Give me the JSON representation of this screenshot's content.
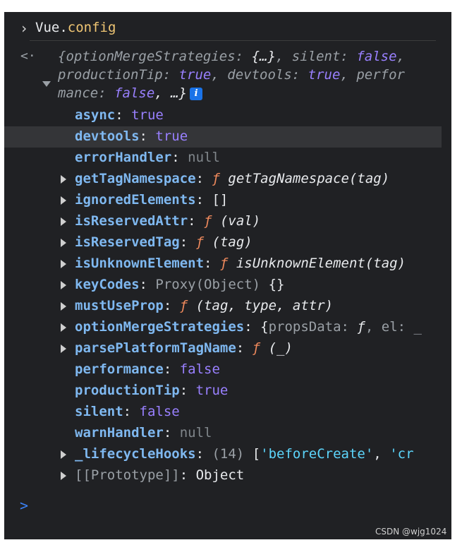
{
  "command": {
    "prompt": ">",
    "object": "Vue",
    "dot": ".",
    "property": "config"
  },
  "result": {
    "arrow": "<·",
    "summary": {
      "line1": [
        {
          "t": "{",
          "c": "grey"
        },
        {
          "t": "optionMergeStrategies",
          "c": "grey"
        },
        {
          "t": ": ",
          "c": "grey"
        },
        {
          "t": "{…}",
          "c": "white"
        },
        {
          "t": ", ",
          "c": "grey"
        },
        {
          "t": "silent",
          "c": "grey"
        },
        {
          "t": ": ",
          "c": "grey"
        },
        {
          "t": "false",
          "c": "bool"
        },
        {
          "t": ",",
          "c": "grey"
        }
      ],
      "line2": [
        {
          "t": "productionTip",
          "c": "grey"
        },
        {
          "t": ": ",
          "c": "grey"
        },
        {
          "t": "true",
          "c": "bool"
        },
        {
          "t": ", ",
          "c": "grey"
        },
        {
          "t": "devtools",
          "c": "grey"
        },
        {
          "t": ": ",
          "c": "grey"
        },
        {
          "t": "true",
          "c": "bool"
        },
        {
          "t": ", ",
          "c": "grey"
        },
        {
          "t": "perfor",
          "c": "grey"
        }
      ],
      "line3": [
        {
          "t": "mance",
          "c": "grey"
        },
        {
          "t": ": ",
          "c": "grey"
        },
        {
          "t": "false",
          "c": "bool"
        },
        {
          "t": ", …}",
          "c": "white"
        }
      ],
      "info_badge": "i"
    },
    "properties": [
      {
        "expandable": false,
        "highlighted": false,
        "key": "async",
        "sep": ": ",
        "value": [
          {
            "t": "true",
            "c": "num"
          }
        ]
      },
      {
        "expandable": false,
        "highlighted": true,
        "key": "devtools",
        "sep": ": ",
        "value": [
          {
            "t": "true",
            "c": "num"
          }
        ]
      },
      {
        "expandable": false,
        "highlighted": false,
        "key": "errorHandler",
        "sep": ": ",
        "value": [
          {
            "t": "null",
            "c": "null"
          }
        ]
      },
      {
        "expandable": true,
        "highlighted": false,
        "key": "getTagNamespace",
        "sep": ": ",
        "value": [
          {
            "t": "ƒ ",
            "c": "fn"
          },
          {
            "t": "getTagNamespace(tag)",
            "c": "white ital"
          }
        ]
      },
      {
        "expandable": true,
        "highlighted": false,
        "key": "ignoredElements",
        "sep": ": ",
        "value": [
          {
            "t": "[]",
            "c": "white"
          }
        ]
      },
      {
        "expandable": true,
        "highlighted": false,
        "key": "isReservedAttr",
        "sep": ": ",
        "value": [
          {
            "t": "ƒ ",
            "c": "fn"
          },
          {
            "t": "(val)",
            "c": "white ital"
          }
        ]
      },
      {
        "expandable": true,
        "highlighted": false,
        "key": "isReservedTag",
        "sep": ": ",
        "value": [
          {
            "t": "ƒ ",
            "c": "fn"
          },
          {
            "t": "(tag)",
            "c": "white ital"
          }
        ]
      },
      {
        "expandable": true,
        "highlighted": false,
        "key": "isUnknownElement",
        "sep": ": ",
        "value": [
          {
            "t": "ƒ ",
            "c": "fn"
          },
          {
            "t": "isUnknownElement(tag)",
            "c": "white ital"
          }
        ]
      },
      {
        "expandable": true,
        "highlighted": false,
        "key": "keyCodes",
        "sep": ": ",
        "value": [
          {
            "t": "Proxy(Object) ",
            "c": "grey"
          },
          {
            "t": "{}",
            "c": "white"
          }
        ]
      },
      {
        "expandable": true,
        "highlighted": false,
        "key": "mustUseProp",
        "sep": ": ",
        "value": [
          {
            "t": "ƒ ",
            "c": "fn"
          },
          {
            "t": "(tag, type, attr)",
            "c": "white ital"
          }
        ]
      },
      {
        "expandable": true,
        "highlighted": false,
        "key": "optionMergeStrategies",
        "sep": ": ",
        "value": [
          {
            "t": "{",
            "c": "white"
          },
          {
            "t": "propsData",
            "c": "grey"
          },
          {
            "t": ": ",
            "c": "grey"
          },
          {
            "t": "ƒ",
            "c": "white ital"
          },
          {
            "t": ", ",
            "c": "grey"
          },
          {
            "t": "el",
            "c": "grey"
          },
          {
            "t": ": _",
            "c": "grey"
          }
        ]
      },
      {
        "expandable": true,
        "highlighted": false,
        "key": "parsePlatformTagName",
        "sep": ": ",
        "value": [
          {
            "t": "ƒ ",
            "c": "fn"
          },
          {
            "t": "(_)",
            "c": "white ital"
          }
        ]
      },
      {
        "expandable": false,
        "highlighted": false,
        "key": "performance",
        "sep": ": ",
        "value": [
          {
            "t": "false",
            "c": "num"
          }
        ]
      },
      {
        "expandable": false,
        "highlighted": false,
        "key": "productionTip",
        "sep": ": ",
        "value": [
          {
            "t": "true",
            "c": "num"
          }
        ]
      },
      {
        "expandable": false,
        "highlighted": false,
        "key": "silent",
        "sep": ": ",
        "value": [
          {
            "t": "false",
            "c": "num"
          }
        ]
      },
      {
        "expandable": false,
        "highlighted": false,
        "key": "warnHandler",
        "sep": ": ",
        "value": [
          {
            "t": "null",
            "c": "null"
          }
        ]
      },
      {
        "expandable": true,
        "highlighted": false,
        "key": "_lifecycleHooks",
        "sep": ": ",
        "value": [
          {
            "t": "(14) ",
            "c": "grey"
          },
          {
            "t": "[",
            "c": "white"
          },
          {
            "t": "'beforeCreate'",
            "c": "strv"
          },
          {
            "t": ", ",
            "c": "white"
          },
          {
            "t": "'cr",
            "c": "strv"
          }
        ]
      },
      {
        "expandable": true,
        "highlighted": false,
        "key": "[[Prototype]]",
        "sep": ": ",
        "value": [
          {
            "t": "Object",
            "c": "white"
          }
        ],
        "dim_key": true
      }
    ]
  },
  "new_prompt": ">",
  "watermark": "CSDN @wjg1024",
  "colors": {
    "background": "#202124",
    "key": "#7fb8f0",
    "boolean": "#9980ff",
    "function": "#f08a5d",
    "string": "#5cd5fb",
    "highlight_row": "#343538"
  }
}
